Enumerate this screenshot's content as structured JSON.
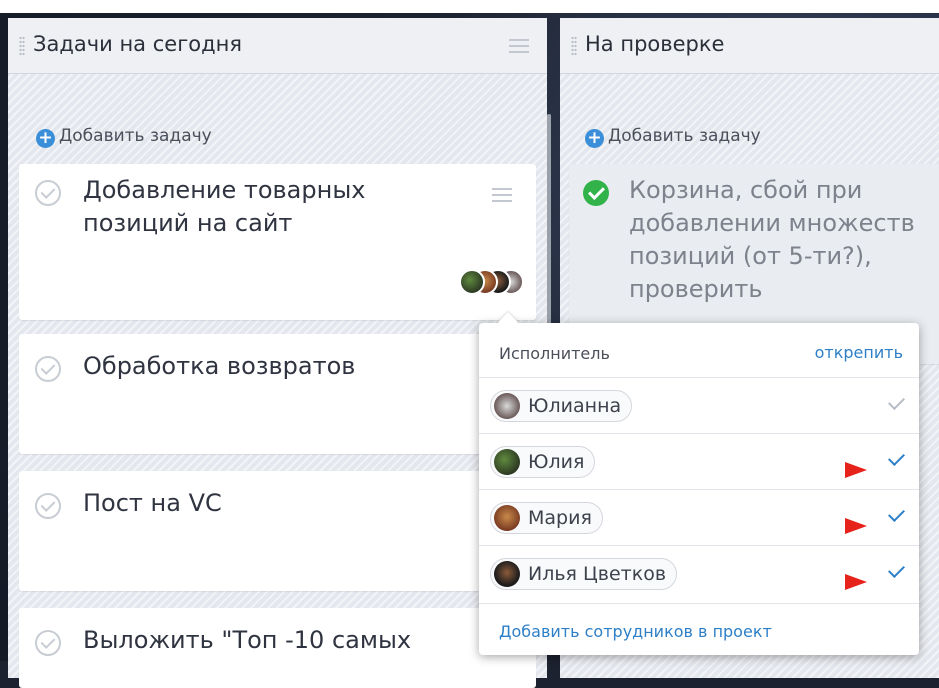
{
  "columns": [
    {
      "title": "Задачи на сегодня",
      "add_task": "Добавить задачу",
      "cards": [
        {
          "text": "Добавление товарных позиций на сайт"
        },
        {
          "text": "Обработка возвратов"
        },
        {
          "text": "Пост на VC"
        },
        {
          "text": "Выложить \"Топ -10 самых"
        }
      ]
    },
    {
      "title": "На проверке",
      "add_task": "Добавить задачу",
      "cards": [
        {
          "text": "Корзина, сбой при добавлении множеств позиций (от 5-ти?), проверить",
          "done": true
        }
      ]
    }
  ],
  "assignee_popup": {
    "title": "Исполнитель",
    "unpin_label": "открепить",
    "assignees": [
      {
        "name": "Юлианна",
        "selected": true,
        "marked": false
      },
      {
        "name": "Юлия",
        "selected": true,
        "marked": true
      },
      {
        "name": "Мария",
        "selected": true,
        "marked": true
      },
      {
        "name": "Илья Цветков",
        "selected": true,
        "marked": true
      }
    ],
    "add_staff_label": "Добавить сотрудников в проект"
  },
  "colors": {
    "accent": "#2d7fc7",
    "done_green": "#32b34a",
    "annotation_red": "#e5231b",
    "column_bg": "#e4e7ed"
  }
}
